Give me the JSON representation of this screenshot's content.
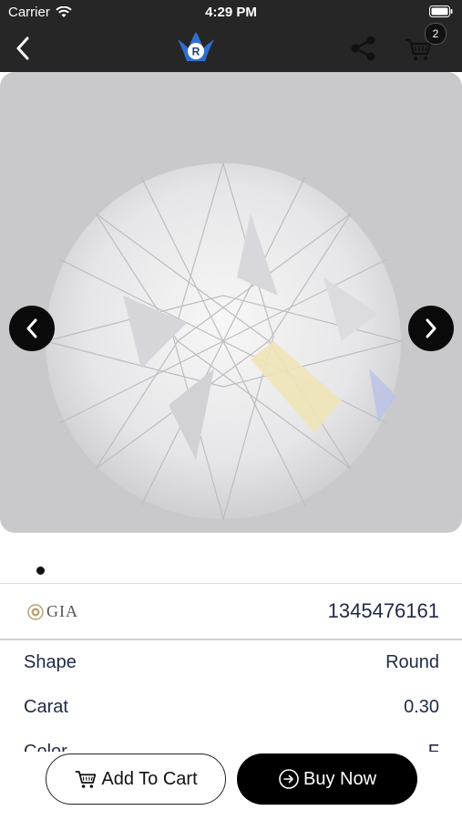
{
  "status_bar": {
    "carrier": "Carrier",
    "time": "4:29 PM"
  },
  "nav": {
    "logo_letter": "R",
    "cart_count": "2"
  },
  "gallery": {
    "page_count": 1,
    "active_page": 1
  },
  "certificate": {
    "lab": "GIA",
    "number": "1345476161"
  },
  "specs": [
    {
      "label": "Shape",
      "value": "Round"
    },
    {
      "label": "Carat",
      "value": "0.30"
    },
    {
      "label": "Color",
      "value": "F"
    }
  ],
  "actions": {
    "add_to_cart": "Add To Cart",
    "buy_now": "Buy Now"
  },
  "colors": {
    "nav_bg": "#262626",
    "text_primary": "#1f2a44",
    "accent_blue": "#2f6fcf"
  }
}
